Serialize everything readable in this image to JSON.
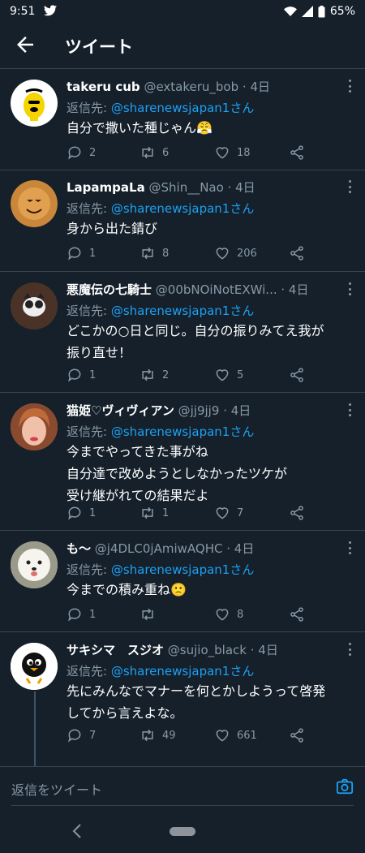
{
  "status": {
    "time": "9:51",
    "battery": "65%"
  },
  "appbar": {
    "title": "ツイート"
  },
  "colors": {
    "background": "#15202b",
    "accent": "#1da1f2",
    "muted": "#8899a6"
  },
  "tweets": [
    {
      "name": "takeru cub",
      "handle": "@extakeru_bob",
      "time": "· 4日",
      "reply_prefix": "返信先: ",
      "reply_mention": "@sharenewsjapan1さん",
      "text": "自分で撒いた種じゃん😤",
      "replies": "2",
      "retweets": "6",
      "likes": "18"
    },
    {
      "name": "LapampaLa",
      "handle": "@Shin__Nao",
      "time": "· 4日",
      "reply_prefix": "返信先: ",
      "reply_mention": "@sharenewsjapan1さん",
      "text": "身から出た錆び",
      "replies": "1",
      "retweets": "8",
      "likes": "206"
    },
    {
      "name": "悪魔伝の七騎士",
      "handle": "@00bNOiNotEXWi...",
      "time": "· 4日",
      "reply_prefix": "返信先: ",
      "reply_mention": "@sharenewsjapan1さん",
      "text": "どこかの○日と同じ。自分の振りみてえ我が\n振り直せ！",
      "replies": "1",
      "retweets": "2",
      "likes": "5"
    },
    {
      "name": "猫姫♡ヴィヴィアン",
      "handle": "@jj9jj9",
      "time": "· 4日",
      "reply_prefix": "返信先: ",
      "reply_mention": "@sharenewsjapan1さん",
      "text": "今までやってきた事がね\n自分達で改めようとしなかったツケが\n受け継がれての結果だよ",
      "replies": "1",
      "retweets": "1",
      "likes": "7"
    },
    {
      "name": "も〜",
      "handle": "@j4DLC0jAmiwAQHC",
      "time": "· 4日",
      "reply_prefix": "返信先: ",
      "reply_mention": "@sharenewsjapan1さん",
      "text": "今までの積み重ね🙁",
      "replies": "1",
      "retweets": "",
      "likes": "8"
    },
    {
      "name": "サキシマ　スジオ",
      "handle": "@sujio_black",
      "time": "· 4日",
      "reply_prefix": "返信先: ",
      "reply_mention": "@sharenewsjapan1さん",
      "text": "先にみんなでマナーを何とかしようって啓発\nしてから言えよな。",
      "replies": "7",
      "retweets": "49",
      "likes": "661"
    }
  ],
  "composer": {
    "placeholder": "返信をツイート"
  },
  "icons": [
    "back-arrow-icon",
    "reply-icon",
    "retweet-icon",
    "like-icon",
    "share-icon",
    "more-icon",
    "camera-icon",
    "wifi-icon",
    "signal-icon",
    "battery-icon",
    "twitter-bird-icon"
  ]
}
